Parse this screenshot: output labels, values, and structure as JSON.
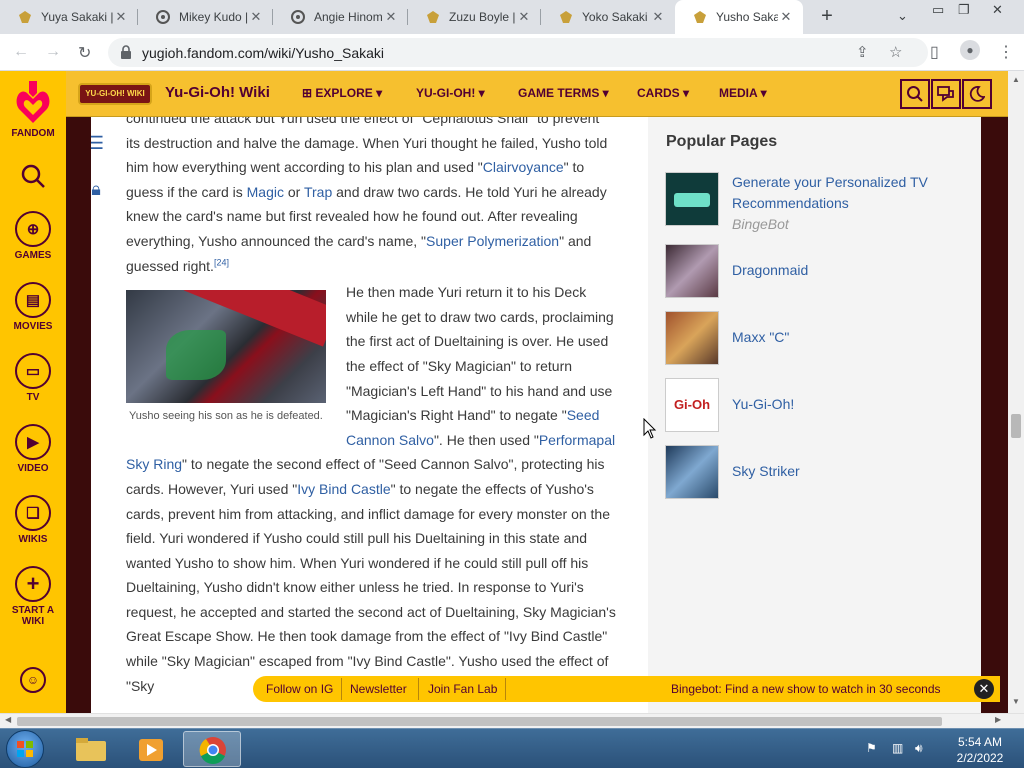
{
  "browser": {
    "tabs": [
      {
        "title": "Yuya Sakaki |"
      },
      {
        "title": "Mikey Kudo |"
      },
      {
        "title": "Angie Hinom"
      },
      {
        "title": "Zuzu Boyle |"
      },
      {
        "title": "Yoko Sakaki"
      },
      {
        "title": "Yusho Sakak",
        "active": true
      }
    ],
    "close_glyph": "✕",
    "new_tab_glyph": "+",
    "url": "yugioh.fandom.com/wiki/Yusho_Sakaki"
  },
  "fandom_bar": {
    "logo_label": "FANDOM",
    "items": [
      {
        "label": "GAMES",
        "icon": "gamepad-icon"
      },
      {
        "label": "MOVIES",
        "icon": "movie-icon"
      },
      {
        "label": "TV",
        "icon": "tv-icon"
      },
      {
        "label": "VIDEO",
        "icon": "play-icon"
      },
      {
        "label": "WIKIS",
        "icon": "book-icon"
      },
      {
        "label": "START A WIKI",
        "icon": "plus-icon"
      }
    ]
  },
  "wiki_nav": {
    "name": "Yu-Gi-Oh! Wiki",
    "logo_text": "YU-GI-OH! WIKI",
    "menus": [
      "EXPLORE",
      "YU-GI-OH!",
      "GAME TERMS",
      "CARDS",
      "MEDIA"
    ]
  },
  "article": {
    "p1_intro": "continued the attack but Yuri used the effect of \"Cephalotus Snail\" to prevent its destruction and halve the damage. When Yuri thought he failed, Yusho told him how everything went according to his plan and used \"",
    "p1_link1": "Clairvoyance",
    "p1_t2": "\" to guess if the card is ",
    "p1_link2": "Magic",
    "p1_t3": " or ",
    "p1_link3": "Trap",
    "p1_t4": " and draw two cards. He told Yuri he already knew the card's name but first revealed how he found out. After revealing everything, Yusho announced the card's name, \"",
    "p1_link4": "Super Polymerization",
    "p1_t5": "\" and guessed right.",
    "p1_ref": "[24]",
    "caption": "Yusho seeing his son as he is defeated.",
    "p2_t1": "He then made Yuri return it to his Deck while he get to draw two cards, proclaiming the first act of Dueltaining is over. He used the effect of \"Sky Magician\" to return \"Magician's Left Hand\" to his hand and use \"Magician's Right Hand\" to negate \"",
    "p2_link1": "Seed Cannon Salvo",
    "p2_t2": "\". He then used \"",
    "p2_link2": "Performapal Sky Ring",
    "p2_t3": "\" to negate the second effect of \"Seed Cannon Salvo\", protecting his cards. However, Yuri used \"",
    "p2_link3": "Ivy Bind Castle",
    "p2_t4": "\" to negate the effects of Yusho's cards, prevent him from attacking, and inflict damage for every monster on the field. Yuri wondered if Yusho could still pull his Dueltaining in this state and wanted Yusho to show him. When Yuri wondered if he could still pull off his Dueltaining, Yusho didn't know either unless he tried. In response to Yuri's request, he accepted and started the second act of Dueltaining, Sky Magician's Great Escape Show. He then took damage from the effect of \"Ivy Bind Castle\" while \"Sky Magician\" escaped from \"Ivy Bind Castle\". Yusho used the effect of \"Sky"
  },
  "popular_pages": {
    "title": "Popular Pages",
    "items": [
      {
        "title": "Generate your Personalized TV Recommendations",
        "subtitle": "BingeBot",
        "thumb_color": "#0f3b3a"
      },
      {
        "title": "Dragonmaid",
        "subtitle": "",
        "thumb_color": "#6b4a5a"
      },
      {
        "title": "Maxx \"C\"",
        "subtitle": "",
        "thumb_color": "#8a5a2a"
      },
      {
        "title": "Yu-Gi-Oh!",
        "subtitle": "",
        "thumb_color": "#c21f1f"
      },
      {
        "title": "Sky Striker",
        "subtitle": "",
        "thumb_color": "#2a4a6a"
      }
    ]
  },
  "notice_bar": {
    "links": [
      "Follow on IG",
      "Newsletter",
      "Join Fan Lab"
    ],
    "message": "Bingebot: Find a new show to watch in 30 seconds"
  },
  "taskbar": {
    "time": "5:54 AM",
    "date": "2/2/2022"
  },
  "colors": {
    "fandom_yellow": "#ffc500",
    "fandom_purple": "#520032",
    "wiki_nav": "#f6c02f",
    "link": "#2f5fa3"
  }
}
